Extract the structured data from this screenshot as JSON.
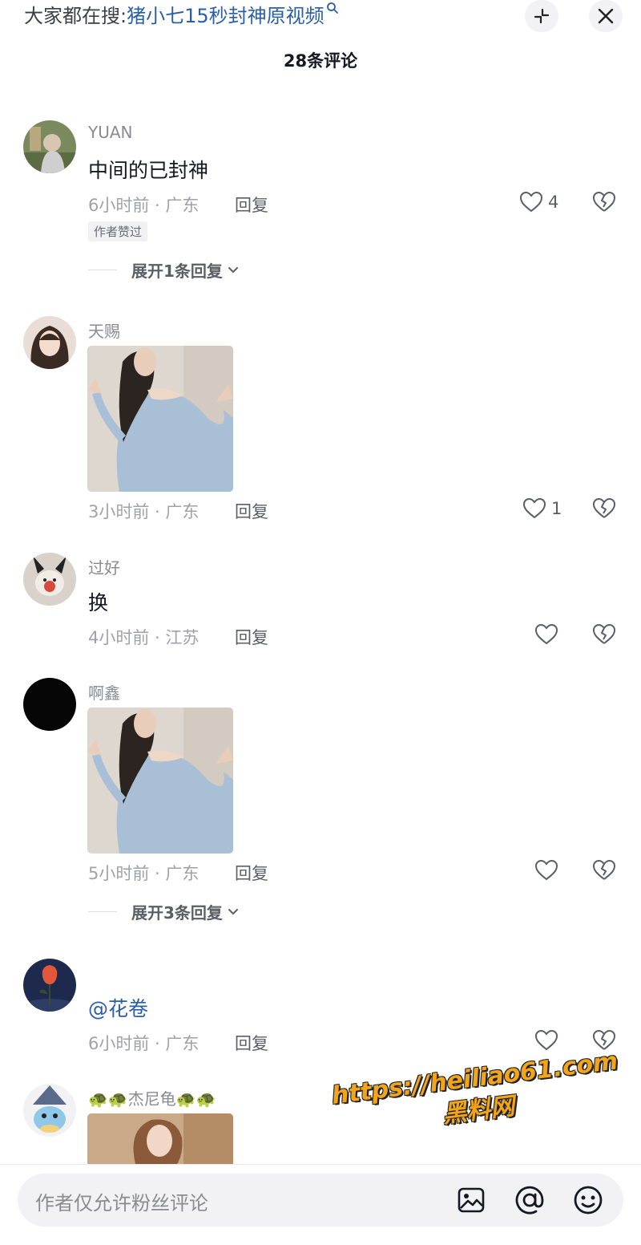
{
  "header": {
    "search_prefix": "大家都在搜:",
    "search_query": "猪小七15秒封神原视频",
    "comment_count": "28条评论",
    "icons": {
      "collapse": "collapse-icon",
      "close": "close-icon",
      "search": "search-icon"
    }
  },
  "comments": [
    {
      "user": "YUAN",
      "text": "中间的已封神",
      "meta": "6小时前 · 广东",
      "reply": "回复",
      "likes": "4",
      "badge": "作者赞过",
      "expand": "展开1条回复"
    },
    {
      "user": "天赐",
      "image": "photo-woman-blue-sweater",
      "meta": "3小时前 · 广东",
      "reply": "回复",
      "likes": "1"
    },
    {
      "user": "过好",
      "text": "换",
      "meta": "4小时前 · 江苏",
      "reply": "回复",
      "likes": ""
    },
    {
      "user": "啊鑫",
      "image": "photo-woman-blue-sweater",
      "meta": "5小时前 · 广东",
      "reply": "回复",
      "likes": "",
      "expand": "展开3条回复"
    },
    {
      "user": "",
      "text": "@花卷",
      "meta": "6小时前 · 广东",
      "reply": "回复",
      "likes": ""
    },
    {
      "user": "🐢🐢杰尼龟🐢🐢",
      "image": "photo-woman-partial"
    }
  ],
  "watermark": {
    "line1": "https://heiliao61.com",
    "line2": "黑料网"
  },
  "input": {
    "placeholder": "作者仅允许粉丝评论",
    "icons": [
      "image-icon",
      "mention-icon",
      "emoji-icon"
    ]
  },
  "colors": {
    "link": "#2a5fa8",
    "muted": "#a1a2a8",
    "watermark": "#f3a51a"
  }
}
